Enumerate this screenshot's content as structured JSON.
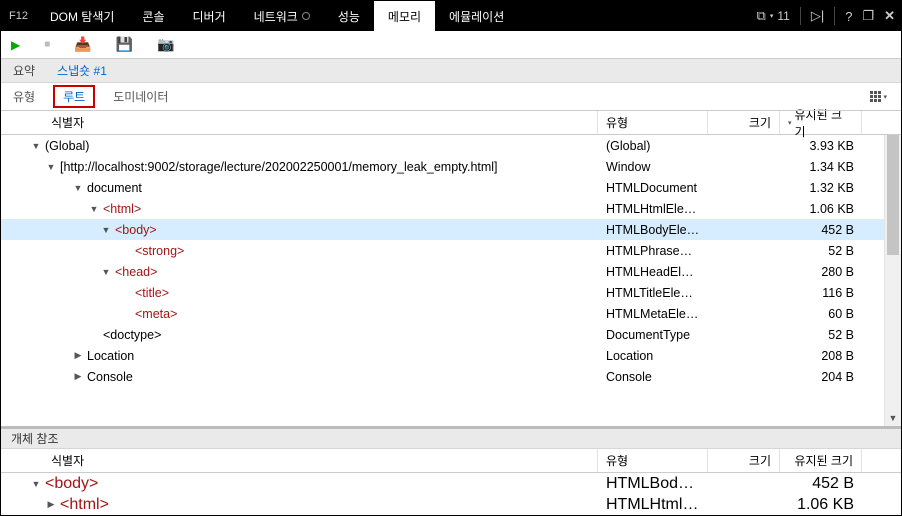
{
  "tabbar": {
    "f12": "F12",
    "tabs": [
      "DOM 탐색기",
      "콘솔",
      "디버거",
      "네트워크",
      "성능",
      "메모리",
      "에뮬레이션"
    ],
    "activeIndex": 5,
    "rightCount": "11"
  },
  "snapbar": {
    "summary": "요약",
    "snapshot": "스냅숏 #1"
  },
  "filterbar": {
    "type": "유형",
    "root": "루트",
    "dominator": "도미네이터"
  },
  "columns": {
    "id": "식별자",
    "type": "유형",
    "size": "크기",
    "retained": "유지된 크기"
  },
  "rows": [
    {
      "indent": 1,
      "arrow": "open",
      "id": "(Global)",
      "html": false,
      "type": "(Global)",
      "size": "",
      "ret": "3.93 KB"
    },
    {
      "indent": 2,
      "arrow": "open",
      "id": "[http://localhost:9002/storage/lecture/202002250001/memory_leak_empty.html]",
      "html": false,
      "type": "Window",
      "size": "",
      "ret": "1.34 KB"
    },
    {
      "indent": 3,
      "arrow": "open",
      "id": "document",
      "html": false,
      "type": "HTMLDocument",
      "size": "",
      "ret": "1.32 KB"
    },
    {
      "indent": 4,
      "arrow": "open",
      "id": "<html>",
      "html": true,
      "type": "HTMLHtmlElement",
      "size": "",
      "ret": "1.06 KB"
    },
    {
      "indent": 5,
      "arrow": "open",
      "id": "<body>",
      "html": true,
      "type": "HTMLBodyElement",
      "size": "",
      "ret": "452 B",
      "selected": true
    },
    {
      "indent": 6,
      "arrow": "",
      "id": "<strong>",
      "html": true,
      "type": "HTMLPhraseElem...",
      "size": "",
      "ret": "52 B"
    },
    {
      "indent": 5,
      "arrow": "open",
      "id": "<head>",
      "html": true,
      "type": "HTMLHeadElement",
      "size": "",
      "ret": "280 B"
    },
    {
      "indent": 6,
      "arrow": "",
      "id": "<title>",
      "html": true,
      "type": "HTMLTitleElement",
      "size": "",
      "ret": "116 B"
    },
    {
      "indent": 6,
      "arrow": "",
      "id": "<meta>",
      "html": true,
      "type": "HTMLMetaElement",
      "size": "",
      "ret": "60 B"
    },
    {
      "indent": 4,
      "arrow": "",
      "id": "<doctype>",
      "html": false,
      "type": "DocumentType",
      "size": "",
      "ret": "52 B"
    },
    {
      "indent": 3,
      "arrow": "closed",
      "id": "Location",
      "html": false,
      "type": "Location",
      "size": "",
      "ret": "208 B"
    },
    {
      "indent": 3,
      "arrow": "closed",
      "id": "Console",
      "html": false,
      "type": "Console",
      "size": "",
      "ret": "204 B"
    }
  ],
  "objref": {
    "title": "개체 참조",
    "rows": [
      {
        "indent": 1,
        "arrow": "open",
        "id": "<body>",
        "html": true,
        "type": "HTMLBodyElement",
        "size": "",
        "ret": "452 B"
      },
      {
        "indent": 2,
        "arrow": "closed",
        "id": "<html>",
        "html": true,
        "type": "HTMLHtmlElement",
        "size": "",
        "ret": "1.06 KB"
      }
    ]
  }
}
